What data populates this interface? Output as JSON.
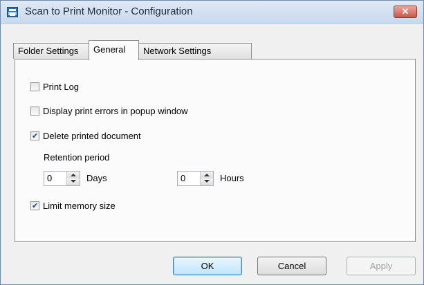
{
  "window": {
    "title": "Scan to Print Monitor - Configuration",
    "close_label": "✕",
    "accent": "#c8584a"
  },
  "tabs": [
    {
      "label": "Folder Settings",
      "active": false
    },
    {
      "label": "General",
      "active": true
    },
    {
      "label": "Network Settings",
      "active": false
    }
  ],
  "general": {
    "print_log": {
      "label": "Print Log",
      "checked": false
    },
    "display_errors": {
      "label": "Display print errors in popup window",
      "checked": false
    },
    "delete_printed": {
      "label": "Delete printed document",
      "checked": true
    },
    "retention_label": "Retention period",
    "days": {
      "value": "0",
      "unit": "Days"
    },
    "hours": {
      "value": "0",
      "unit": "Hours"
    },
    "limit_memory": {
      "label": "Limit memory size",
      "checked": true
    }
  },
  "buttons": {
    "ok": "OK",
    "cancel": "Cancel",
    "apply": "Apply"
  }
}
